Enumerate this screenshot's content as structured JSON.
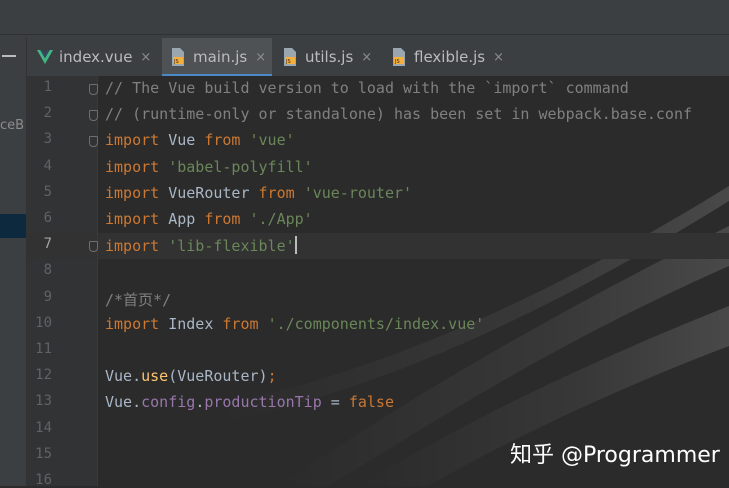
{
  "left_panel": {
    "clipped_text": "ceB"
  },
  "tabs": [
    {
      "label": "index.vue",
      "icon": "vue-icon",
      "active": false,
      "close": "×"
    },
    {
      "label": "main.js",
      "icon": "js-file-icon",
      "active": true,
      "close": "×"
    },
    {
      "label": "utils.js",
      "icon": "js-file-icon",
      "active": false,
      "close": "×"
    },
    {
      "label": "flexible.js",
      "icon": "js-file-icon",
      "active": false,
      "close": "×"
    }
  ],
  "editor": {
    "current_line": 7,
    "line_numbers": [
      "1",
      "2",
      "3",
      "4",
      "5",
      "6",
      "7",
      "8",
      "9",
      "10",
      "11",
      "12",
      "13",
      "14",
      "15",
      "16"
    ],
    "lines": [
      [
        {
          "t": "// The Vue build version to load with the `import` command",
          "c": "cmt"
        }
      ],
      [
        {
          "t": "// (runtime-only or standalone) has been set in webpack.base.conf",
          "c": "cmt"
        }
      ],
      [
        {
          "t": "import",
          "c": "kw"
        },
        {
          "t": " Vue ",
          "c": ""
        },
        {
          "t": "from",
          "c": "kw"
        },
        {
          "t": " ",
          "c": ""
        },
        {
          "t": "'vue'",
          "c": "str"
        }
      ],
      [
        {
          "t": "import",
          "c": "kw"
        },
        {
          "t": " ",
          "c": ""
        },
        {
          "t": "'babel-polyfill'",
          "c": "str"
        }
      ],
      [
        {
          "t": "import",
          "c": "kw"
        },
        {
          "t": " VueRouter ",
          "c": ""
        },
        {
          "t": "from",
          "c": "kw"
        },
        {
          "t": " ",
          "c": ""
        },
        {
          "t": "'vue-router'",
          "c": "str"
        }
      ],
      [
        {
          "t": "import",
          "c": "kw"
        },
        {
          "t": " App ",
          "c": ""
        },
        {
          "t": "from",
          "c": "kw"
        },
        {
          "t": " ",
          "c": ""
        },
        {
          "t": "'./App'",
          "c": "str"
        }
      ],
      [
        {
          "t": "import",
          "c": "kw"
        },
        {
          "t": " ",
          "c": ""
        },
        {
          "t": "'lib-flexible'",
          "c": "str"
        }
      ],
      [],
      [
        {
          "t": "/*首页*/",
          "c": "cmt"
        }
      ],
      [
        {
          "t": "import",
          "c": "kw"
        },
        {
          "t": " Index ",
          "c": ""
        },
        {
          "t": "from",
          "c": "kw"
        },
        {
          "t": " ",
          "c": ""
        },
        {
          "t": "'./components/index.vue'",
          "c": "str"
        }
      ],
      [],
      [
        {
          "t": "Vue.",
          "c": ""
        },
        {
          "t": "use",
          "c": "fn"
        },
        {
          "t": "(VueRouter)",
          "c": ""
        },
        {
          "t": ";",
          "c": "kw"
        }
      ],
      [
        {
          "t": "Vue.",
          "c": ""
        },
        {
          "t": "config",
          "c": "prop"
        },
        {
          "t": ".",
          "c": ""
        },
        {
          "t": "productionTip",
          "c": "prop"
        },
        {
          "t": " = ",
          "c": ""
        },
        {
          "t": "false",
          "c": "kw"
        }
      ],
      [],
      [],
      []
    ],
    "fold_markers_at_lines": [
      1,
      2,
      3,
      7
    ],
    "inspection_status": "✔"
  },
  "watermark": "知乎 @Programmer",
  "colors": {
    "keyword": "#cc7832",
    "string": "#6a8759",
    "comment": "#808080",
    "property": "#9876aa",
    "function": "#ffc66d",
    "plain": "#a9b7c6",
    "active_tab_underline": "#4a88c7"
  }
}
